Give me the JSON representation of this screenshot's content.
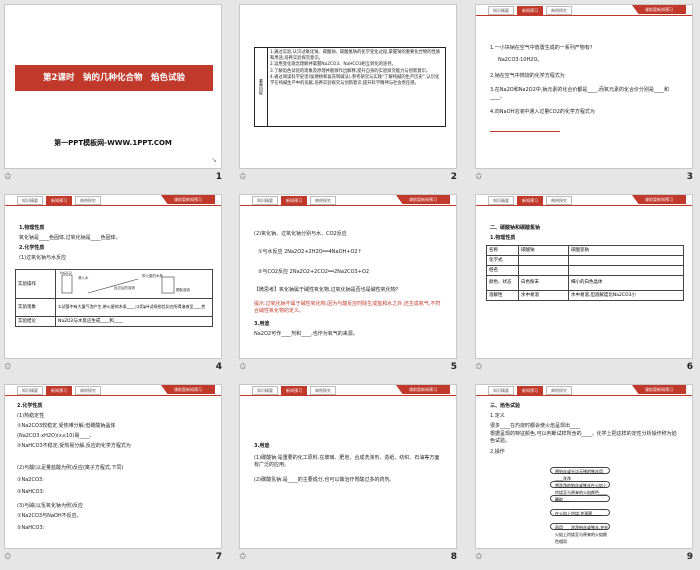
{
  "grid_color": "#e6e6e6",
  "accent": "#c0392b",
  "star_glyph": "✩",
  "tabs": [
    "知识精要",
    "新知预习",
    "典例探究"
  ],
  "badge": "课前案新知预习",
  "slides": [
    {
      "num": "1",
      "title": "第2课时　钠的几种化合物　焰色试验",
      "site": "第一PPT模板网-WWW.1PPT.COM",
      "corner": "↘"
    },
    {
      "num": "2",
      "box_label": "素养目标",
      "lines": [
        "1.通过实验,认识过氧化钠、碳酸钠、碳酸氢钠的化学变化过程,掌握钠的重要化合物的性质和用途,培养实验探究意识。",
        "2.运用变化观念理解并掌握Na2CO3、NaHCO3相互转化的途径。",
        "3.了解焰色试验的现象及原理并能够作出解释,提升自身的实验探究能力与创新意识。",
        "4.通过阅读科学史话(侯德榜和侯氏制碱法),参考研究与实践“了解纯碱的生产历史”,认识化学在纯碱生产中的贡献,培养实验探究与创新意识,提升科学精神与社会责任感。"
      ]
    },
    {
      "num": "3",
      "lines": [
        "1.一小块钠在空气中放置生成的一系列产物有?",
        "Na2CO3·10H2O。",
        "2.钠在空气中燃烧的化学方程式为",
        "3.在Na2O和Na2O2中,钠元素的化合价都是____,而氧元素的化合价分别是____和____。",
        "4.向NaOH溶液中通入过量CO2的化学方程式为"
      ]
    },
    {
      "num": "4",
      "lines": [
        "1.物理性质",
        "氧化钠是____色固体,过氧化钠是____色固体。",
        "2.化学性质",
        "(1)过氧化钠与水反应"
      ],
      "diagram_labels": [
        "Na2O2",
        "滴入水",
        "反应后的溶液",
        "带火星的木条",
        "酚酞溶液"
      ],
      "table": [
        {
          "k": "实验操作",
          "v": ""
        },
        {
          "k": "实验现象",
          "v": "①试管中有大量气泡产生,带火星的木条____;②用pH试纸检验反应所得溶液呈____性"
        },
        {
          "k": "实验结论",
          "v": "Na2O2与水反应生成____和____"
        }
      ]
    },
    {
      "num": "5",
      "lines": [
        "(2)氧化钠、过氧化钠分别与水、CO2反应",
        "①与水反应 2Na2O2+2H2O══4NaOH+O2↑",
        "②与CO2反应 2Na2O2+2CO2══2Na2CO3+O2",
        "【微思考】氧化钠属于碱性氧化物,过氧化钠是否也是碱性氧化物?",
        "提示:过氧化钠不属于碱性氧化物,因为与酸反应时除生成盐和水之外,还生成氧气,不符合碱性氧化物的定义。",
        "3.用途",
        "Na2O2可作____剂和____,也作为氧气的来源。"
      ]
    },
    {
      "num": "6",
      "lines": [
        "二、碳酸钠和碳酸氢钠",
        "1.物理性质"
      ],
      "table": [
        [
          "名称",
          "碳酸钠",
          "碳酸氢钠"
        ],
        [
          "化学式",
          "",
          ""
        ],
        [
          "俗名",
          "",
          ""
        ],
        [
          "颜色、状态",
          "白色粉末",
          "细小的白色晶体"
        ],
        [
          "溶解性",
          "水中易溶",
          "水中易溶,但溶解度比Na2CO3小"
        ]
      ]
    },
    {
      "num": "7",
      "lines": [
        "2.化学性质",
        "(1)热稳定性",
        "①Na2CO3较稳定,受热难分解;但碳酸钠晶体",
        "(Na2CO3·xH2O)(x≤10)易____。",
        "②NaHCO3不稳定,受热易分解,反应的化学方程式为",
        "(2)与酸(以足量盐酸为例)反应(离子方程式,下同)",
        "①Na2CO3:",
        "②NaHCO3:",
        "(3)与碱(以氢氧化钠为例)反应",
        "①Na2CO3与NaOH不反应。",
        "②NaHCO3:"
      ]
    },
    {
      "num": "8",
      "lines": [
        "3.用途",
        "(1)碳酸钠:是重要的化工原料,在玻璃、肥皂、合成洗涤剂、造纸、纺织、石油等方面有广泛的应用。",
        "(2)碳酸氢钠:是____的主要成分,也可以做治疗胃酸过多的药剂。"
      ]
    },
    {
      "num": "9",
      "lines": [
        "三、焰色试验",
        "1.定义",
        "很多____在灼烧时都会使火焰呈现出____",
        "根据呈现的特征颜色,可以判断试样所含的____。化学上把这样的定性分析操作称为焰色试验。",
        "2.操作"
      ],
      "steps": [
        "将铂丝或光洁无锈的铁丝用____洗净",
        "将洗净的铂丝或铁丝在火焰上灼烧至与原来的火焰颜色____",
        "蘸取____",
        "在火焰上灼烧,并观察____",
        "再用____洗净铂丝或铁丝,并在火焰上灼烧至与原来的火焰颜色相同"
      ]
    }
  ]
}
